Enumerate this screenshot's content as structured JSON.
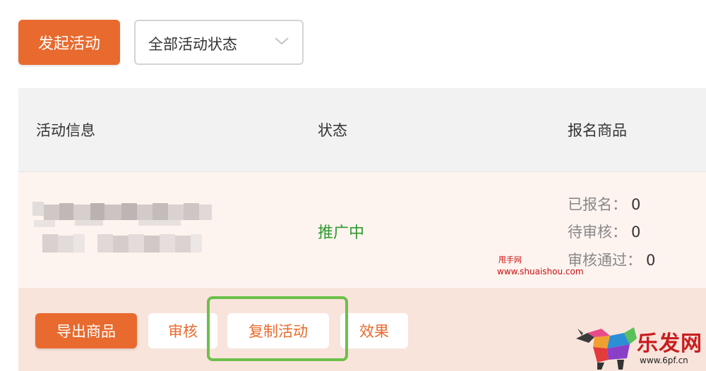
{
  "toolbar": {
    "launch_button": "发起活动",
    "status_filter": {
      "selected": "全部活动状态"
    }
  },
  "table": {
    "columns": [
      "活动信息",
      "状态",
      "报名商品"
    ]
  },
  "row": {
    "status": "推广中",
    "stats": [
      {
        "label": "已报名：",
        "value": "0"
      },
      {
        "label": "待审核：",
        "value": "0"
      },
      {
        "label": "审核通过：",
        "value": "0"
      }
    ],
    "actions": {
      "export": "导出商品",
      "review": "审核",
      "copy": "复制活动",
      "effect": "效果"
    }
  },
  "watermark": {
    "site_name": "甩手网",
    "site_url": "www.shuaishou.com",
    "logo_text": "乐发网",
    "logo_url": "www.6pf.cn"
  },
  "colors": {
    "accent": "#e86a2e",
    "status_active": "#2e9b2e",
    "highlight": "#6cc04a"
  }
}
